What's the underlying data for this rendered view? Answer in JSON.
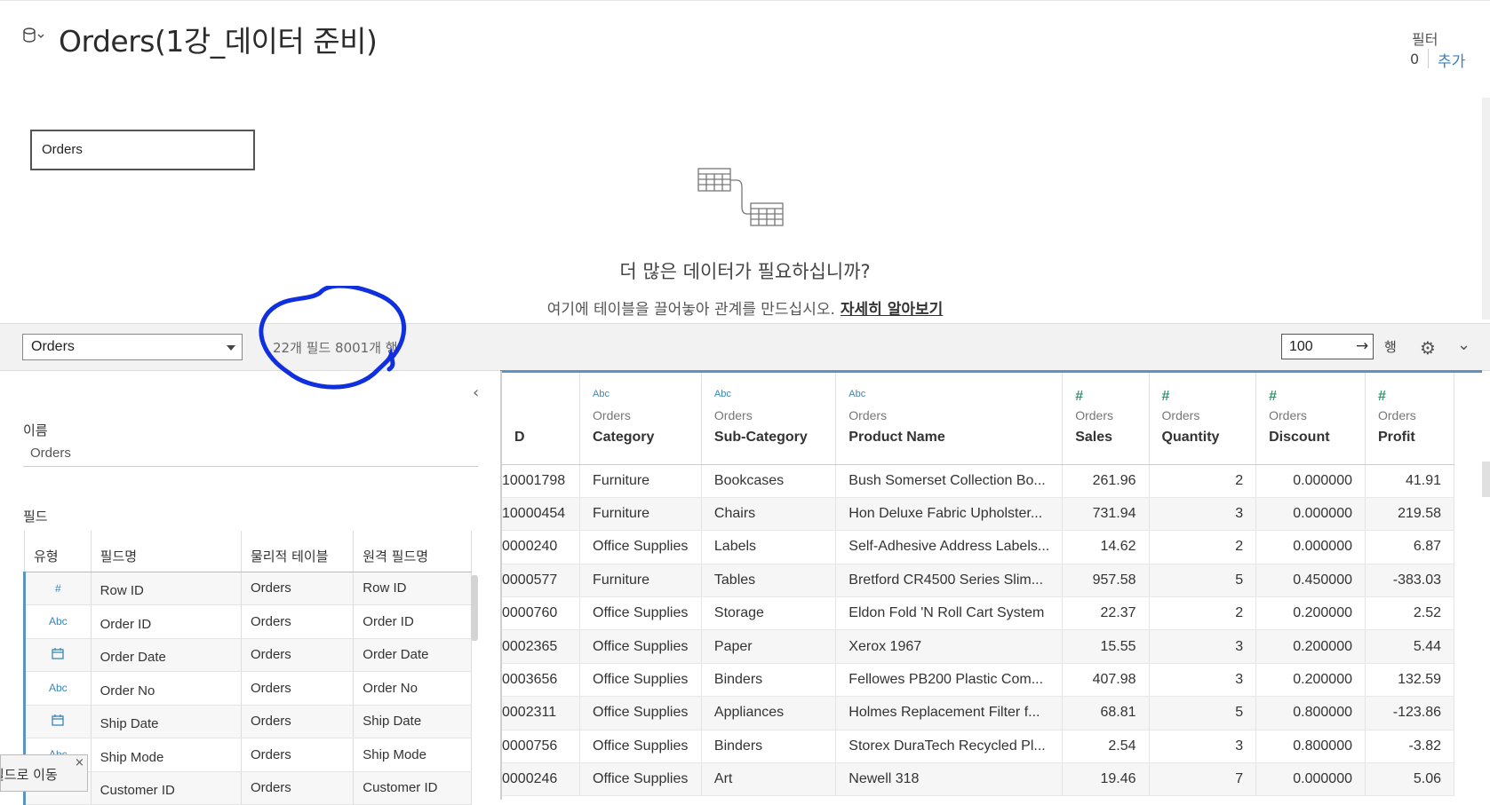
{
  "header": {
    "title": "Orders(1강_데이터 준비)",
    "filter_label": "필터",
    "filter_count": "0",
    "filter_add": "추가"
  },
  "canvas": {
    "table_name": "Orders",
    "more_data_title": "더 많은 데이터가 필요하십니까?",
    "more_data_text": "여기에 테이블을 끌어놓아 관계를 만드십시오.",
    "more_data_link": "자세히 알아보기"
  },
  "toolbar": {
    "selected_table": "Orders",
    "counts": "22개 필드 8001개 행",
    "rows_value": "100",
    "rows_go": "→",
    "rows_unit": "행"
  },
  "left_panel": {
    "name_label": "이름",
    "name_value": "Orders",
    "fields_label": "필드",
    "columns": [
      "유형",
      "필드명",
      "물리적 테이블",
      "원격 필드명"
    ],
    "fields": [
      {
        "type": "#",
        "name": "Row ID",
        "table": "Orders",
        "remote": "Row ID"
      },
      {
        "type": "Abc",
        "name": "Order ID",
        "table": "Orders",
        "remote": "Order ID"
      },
      {
        "type": "date",
        "name": "Order Date",
        "table": "Orders",
        "remote": "Order Date"
      },
      {
        "type": "Abc",
        "name": "Order No",
        "table": "Orders",
        "remote": "Order No"
      },
      {
        "type": "date",
        "name": "Ship Date",
        "table": "Orders",
        "remote": "Ship Date"
      },
      {
        "type": "Abc",
        "name": "Ship Mode",
        "table": "Orders",
        "remote": "Ship Mode"
      },
      {
        "type": "Abc",
        "name": "Customer ID",
        "table": "Orders",
        "remote": "Customer ID"
      }
    ],
    "tooltip_text": "필드로 이동",
    "tooltip_close": "×"
  },
  "grid": {
    "source_label": "Orders",
    "columns": [
      {
        "type": "",
        "name": "D"
      },
      {
        "type": "Abc",
        "name": "Category"
      },
      {
        "type": "Abc",
        "name": "Sub-Category"
      },
      {
        "type": "Abc",
        "name": "Product Name"
      },
      {
        "type": "#",
        "name": "Sales"
      },
      {
        "type": "#",
        "name": "Quantity"
      },
      {
        "type": "#",
        "name": "Discount"
      },
      {
        "type": "#",
        "name": "Profit"
      }
    ],
    "rows": [
      [
        "10001798",
        "Furniture",
        "Bookcases",
        "Bush Somerset Collection Bo...",
        "261.96",
        "2",
        "0.000000",
        "41.91"
      ],
      [
        "10000454",
        "Furniture",
        "Chairs",
        "Hon Deluxe Fabric Upholster...",
        "731.94",
        "3",
        "0.000000",
        "219.58"
      ],
      [
        "0000240",
        "Office Supplies",
        "Labels",
        "Self-Adhesive Address Labels...",
        "14.62",
        "2",
        "0.000000",
        "6.87"
      ],
      [
        "0000577",
        "Furniture",
        "Tables",
        "Bretford CR4500 Series Slim...",
        "957.58",
        "5",
        "0.450000",
        "-383.03"
      ],
      [
        "0000760",
        "Office Supplies",
        "Storage",
        "Eldon Fold 'N Roll Cart System",
        "22.37",
        "2",
        "0.200000",
        "2.52"
      ],
      [
        "0002365",
        "Office Supplies",
        "Paper",
        "Xerox 1967",
        "15.55",
        "3",
        "0.200000",
        "5.44"
      ],
      [
        "0003656",
        "Office Supplies",
        "Binders",
        "Fellowes PB200 Plastic Com...",
        "407.98",
        "3",
        "0.200000",
        "132.59"
      ],
      [
        "0002311",
        "Office Supplies",
        "Appliances",
        "Holmes Replacement Filter f...",
        "68.81",
        "5",
        "0.800000",
        "-123.86"
      ],
      [
        "0000756",
        "Office Supplies",
        "Binders",
        "Storex DuraTech Recycled Pl...",
        "2.54",
        "3",
        "0.800000",
        "-3.82"
      ],
      [
        "0000246",
        "Office Supplies",
        "Art",
        "Newell 318",
        "19.46",
        "7",
        "0.000000",
        "5.06"
      ]
    ]
  },
  "colors": {
    "accent": "#5b93c4",
    "link": "#3a7ebf",
    "annotation": "#1030e0",
    "measure_icon": "#2f9a6c"
  }
}
